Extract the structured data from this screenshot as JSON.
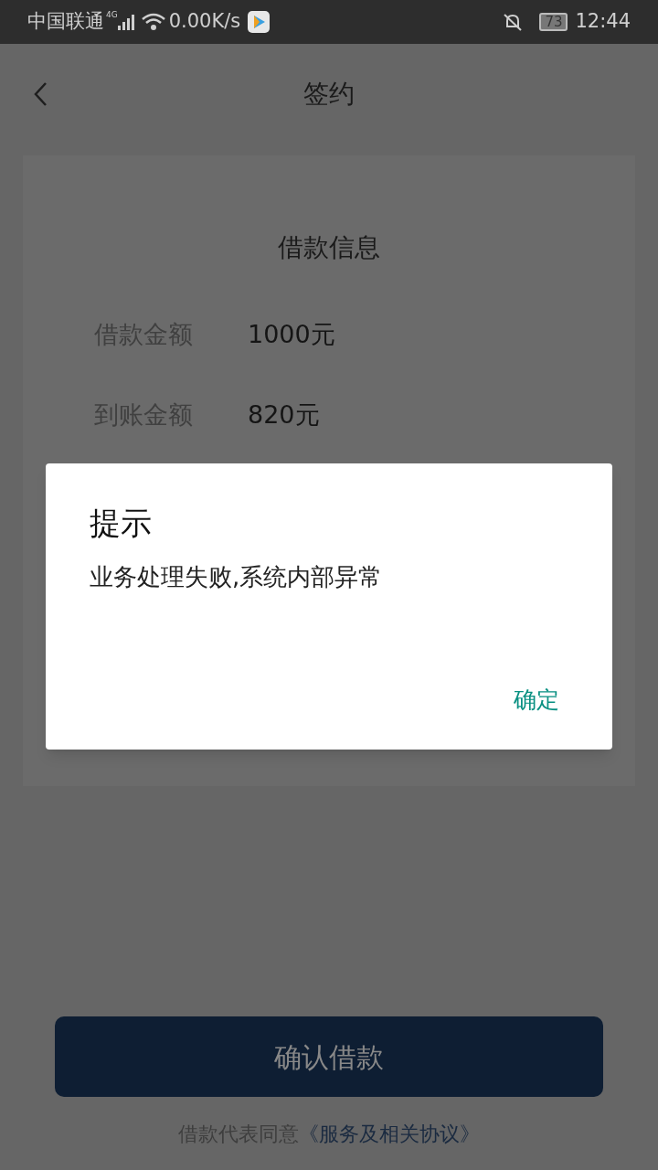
{
  "status_bar": {
    "carrier": "中国联通",
    "network": "4G",
    "speed": "0.00K/s",
    "battery": "73",
    "time": "12:44"
  },
  "header": {
    "title": "签约"
  },
  "card": {
    "title": "借款信息",
    "rows": [
      {
        "label": "借款金额",
        "value": "1000元"
      },
      {
        "label": "到账金额",
        "value": "820元"
      }
    ]
  },
  "dialog": {
    "title": "提示",
    "message": "业务处理失败,系统内部异常",
    "button": "确定"
  },
  "confirm_button": "确认借款",
  "agreement": {
    "text": "借款代表同意",
    "link": "《服务及相关协议》"
  }
}
